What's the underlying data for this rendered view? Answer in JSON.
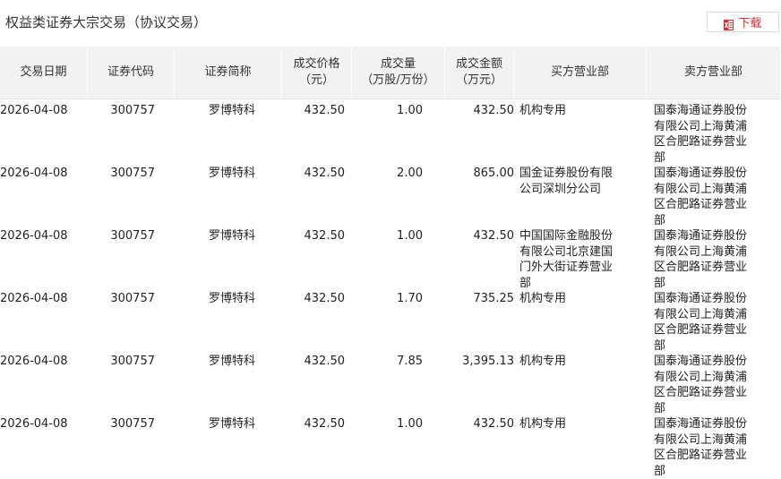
{
  "header": {
    "title": "权益类证券大宗交易（协议交易）",
    "download_label": "下载",
    "download_icon": "excel-download-icon"
  },
  "columns": [
    {
      "key": "date",
      "lines": [
        "交易日期"
      ]
    },
    {
      "key": "code",
      "lines": [
        "证券代码"
      ]
    },
    {
      "key": "name",
      "lines": [
        "证券简称"
      ]
    },
    {
      "key": "price",
      "lines": [
        "成交价格",
        "（元）"
      ]
    },
    {
      "key": "volume",
      "lines": [
        "成交量",
        "（万股/万份）"
      ]
    },
    {
      "key": "amount",
      "lines": [
        "成交金额",
        "（万元）"
      ]
    },
    {
      "key": "buyer",
      "lines": [
        "买方营业部"
      ]
    },
    {
      "key": "seller",
      "lines": [
        "卖方营业部"
      ]
    }
  ],
  "rows": [
    {
      "date": "2026-04-08",
      "code": "300757",
      "name": "罗博特科",
      "price": "432.50",
      "volume": "1.00",
      "amount": "432.50",
      "buyer": "机构专用",
      "seller": "国泰海通证券股份有限公司上海黄浦区合肥路证券营业部"
    },
    {
      "date": "2026-04-08",
      "code": "300757",
      "name": "罗博特科",
      "price": "432.50",
      "volume": "2.00",
      "amount": "865.00",
      "buyer": "国金证券股份有限公司深圳分公司",
      "seller": "国泰海通证券股份有限公司上海黄浦区合肥路证券营业部"
    },
    {
      "date": "2026-04-08",
      "code": "300757",
      "name": "罗博特科",
      "price": "432.50",
      "volume": "1.00",
      "amount": "432.50",
      "buyer": "中国国际金融股份有限公司北京建国门外大街证券营业部",
      "seller": "国泰海通证券股份有限公司上海黄浦区合肥路证券营业部"
    },
    {
      "date": "2026-04-08",
      "code": "300757",
      "name": "罗博特科",
      "price": "432.50",
      "volume": "1.70",
      "amount": "735.25",
      "buyer": "机构专用",
      "seller": "国泰海通证券股份有限公司上海黄浦区合肥路证券营业部"
    },
    {
      "date": "2026-04-08",
      "code": "300757",
      "name": "罗博特科",
      "price": "432.50",
      "volume": "7.85",
      "amount": "3,395.13",
      "buyer": "机构专用",
      "seller": "国泰海通证券股份有限公司上海黄浦区合肥路证券营业部"
    },
    {
      "date": "2026-04-08",
      "code": "300757",
      "name": "罗博特科",
      "price": "432.50",
      "volume": "1.00",
      "amount": "432.50",
      "buyer": "机构专用",
      "seller": "国泰海通证券股份有限公司上海黄浦区合肥路证券营业部"
    }
  ],
  "colors": {
    "accent": "#d9302d",
    "header_bg": "#f2f2f2"
  }
}
